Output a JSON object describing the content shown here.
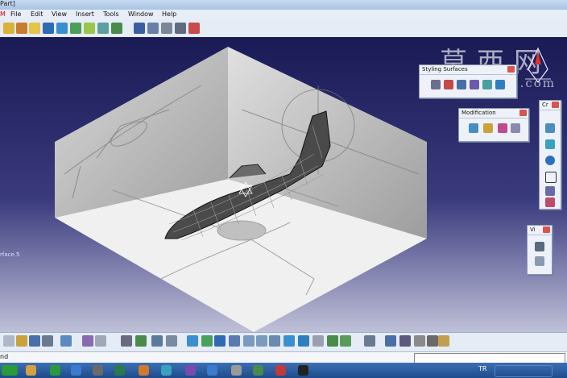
{
  "window": {
    "title_fragment": "Part]"
  },
  "menu": {
    "items": [
      "File",
      "Edit",
      "View",
      "Insert",
      "Tools",
      "Window",
      "Help"
    ]
  },
  "watermark": {
    "chinese": "莫西网",
    "url": "www.3dmox.com"
  },
  "panels": {
    "styling_surfaces": {
      "title": "Styling Surfaces"
    },
    "modification": {
      "title": "Modification"
    },
    "right_panel": {
      "title": "Cr"
    },
    "view_panel": {
      "title": "Vi"
    }
  },
  "viewport": {
    "selected_label": "rface.5"
  },
  "command_bar": {
    "label": "nd"
  },
  "taskbar": {
    "lang": "TR"
  },
  "colors": {
    "viewport_top": "#1a1a55",
    "viewport_bottom": "#bfc0d8",
    "panel_bg": "#eef2f8",
    "close": "#d9534f"
  }
}
